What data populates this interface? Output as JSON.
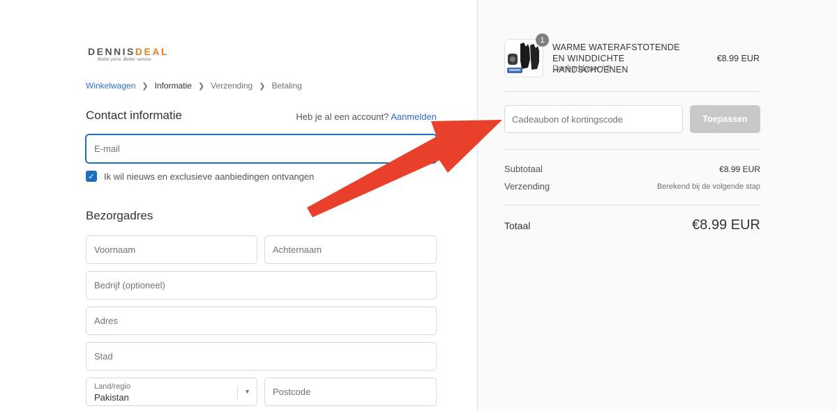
{
  "logo": {
    "word_a": "DENNIS",
    "word_b": "DEAL",
    "tagline": "Better price, Better service"
  },
  "breadcrumb": [
    {
      "label": "Winkelwagen",
      "state": "link"
    },
    {
      "label": "Informatie",
      "state": "active"
    },
    {
      "label": "Verzending",
      "state": "inactive"
    },
    {
      "label": "Betaling",
      "state": "inactive"
    }
  ],
  "contact": {
    "title": "Contact informatie",
    "account_prompt": "Heb je al een account?",
    "login_link": "Aanmelden",
    "email_placeholder": "E-mail",
    "newsletter_label": "Ik wil nieuws en exclusieve aanbiedingen ontvangen",
    "newsletter_checked": true
  },
  "shipping": {
    "title": "Bezorgadres",
    "first_name_placeholder": "Voornaam",
    "last_name_placeholder": "Achternaam",
    "company_placeholder": "Bedrijf (optioneel)",
    "address_placeholder": "Adres",
    "city_placeholder": "Stad",
    "country_label": "Land/regio",
    "country_value": "Pakistan",
    "postcode_placeholder": "Postcode"
  },
  "summary": {
    "product": {
      "name": "WARME WATERAFSTOTENDE EN WINDDICHTE HANDSCHOENEN",
      "variant": "Donkerblauw / S",
      "price": "€8.99 EUR",
      "quantity": "1"
    },
    "discount_placeholder": "Cadeaubon of kortingscode",
    "apply_label": "Toepassen",
    "subtotal_label": "Subtotaal",
    "subtotal_value": "€8.99 EUR",
    "shipping_label": "Verzending",
    "shipping_value": "Berekend bij de volgende stap",
    "total_label": "Totaal",
    "total_value": "€8.99 EUR"
  },
  "colors": {
    "accent": "#1f6fbf",
    "link": "#2c6ecb",
    "arrow": "#e8402a",
    "logo_accent": "#e67e22"
  }
}
